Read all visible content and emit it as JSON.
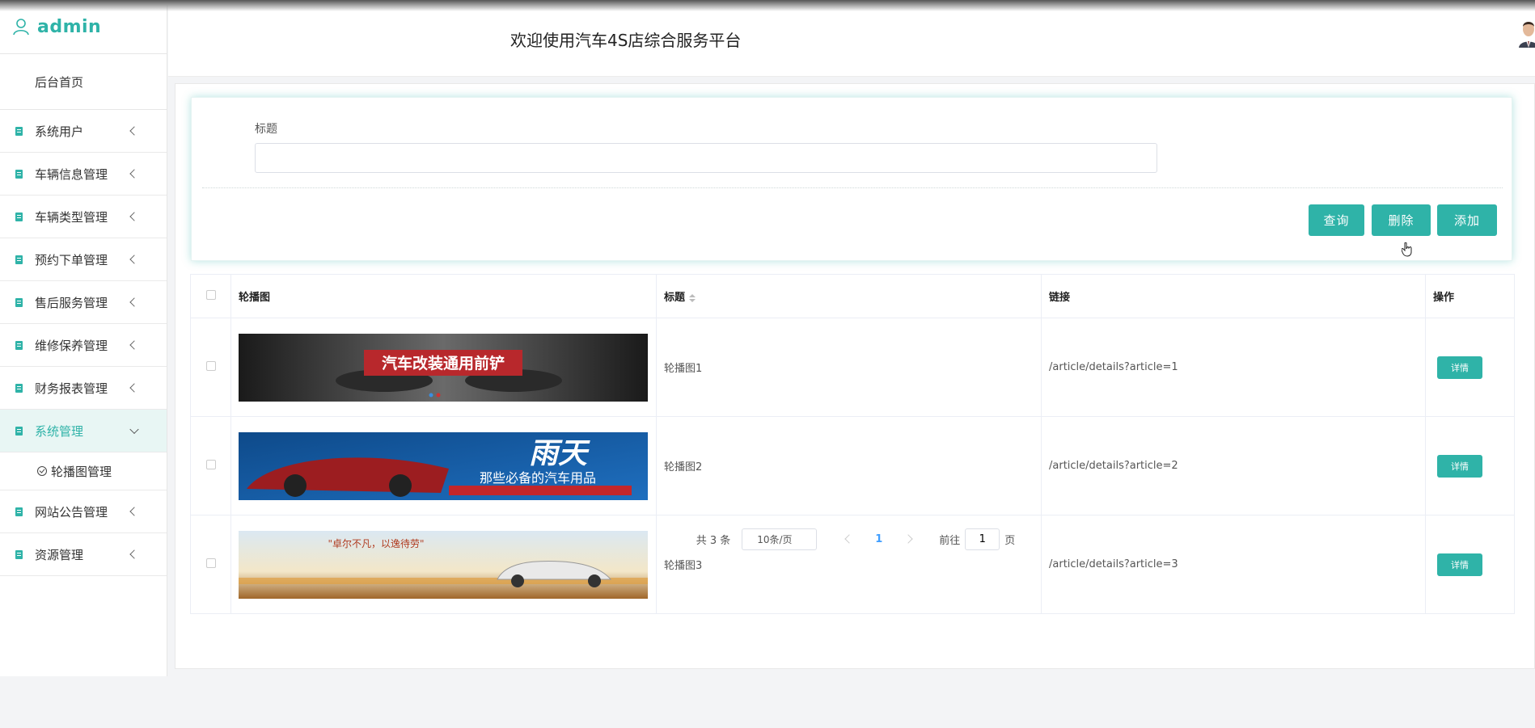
{
  "sidebar": {
    "brand": "admin",
    "home": "后台首页",
    "items": [
      {
        "label": "系统用户"
      },
      {
        "label": "车辆信息管理"
      },
      {
        "label": "车辆类型管理"
      },
      {
        "label": "预约下单管理"
      },
      {
        "label": "售后服务管理"
      },
      {
        "label": "维修保养管理"
      },
      {
        "label": "财务报表管理"
      },
      {
        "label": "系统管理"
      },
      {
        "label": "网站公告管理"
      },
      {
        "label": "资源管理"
      }
    ],
    "sub_item": "轮播图管理"
  },
  "header": {
    "title": "欢迎使用汽车4S店综合服务平台"
  },
  "search": {
    "label": "标题",
    "value": "",
    "placeholder": ""
  },
  "buttons": {
    "query": "查询",
    "delete": "删除",
    "add": "添加"
  },
  "table": {
    "headers": [
      "轮播图",
      "标题",
      "链接",
      "操作"
    ],
    "rows": [
      {
        "banner_text": "汽车改装通用前铲",
        "title": "轮播图1",
        "link": "/article/details?article=1",
        "action": "详情"
      },
      {
        "banner_text": "雨天",
        "banner_sub": "那些必备的汽车用品",
        "title": "轮播图2",
        "link": "/article/details?article=2",
        "action": "详情"
      },
      {
        "banner_text": "\"卓尔不凡，以逸待劳\"",
        "title": "轮播图3",
        "link": "/article/details?article=3",
        "action": "详情"
      }
    ]
  },
  "pagination": {
    "total": "共 3 条",
    "page_size": "10条/页",
    "current_page": "1",
    "goto_prefix": "前往",
    "goto_value": "1",
    "goto_suffix": "页"
  },
  "colors": {
    "accent": "#2fb3a8",
    "link": "#409eff"
  }
}
